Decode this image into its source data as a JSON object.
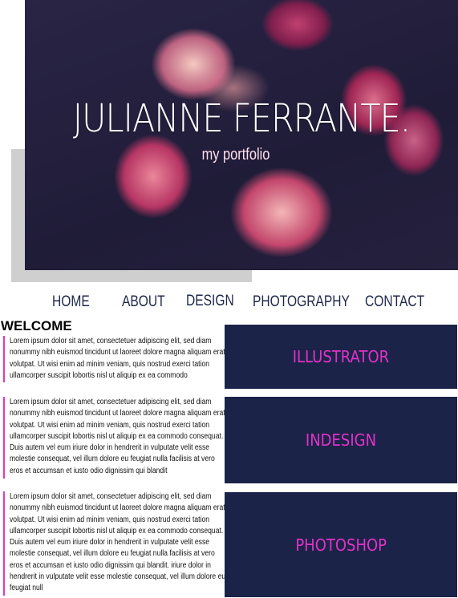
{
  "hero": {
    "title": "JULIANNE FERRANTE.",
    "subtitle": "my portfolio"
  },
  "nav": {
    "items": [
      "HOME",
      "ABOUT",
      "DESIGN",
      "PHOTOGRAPHY",
      "CONTACT"
    ]
  },
  "welcome": {
    "heading": "WELCOME"
  },
  "paragraphs": [
    "Lorem ipsum dolor sit amet, consectetuer adipiscing elit, sed diam nonummy nibh euismod tincidunt ut laoreet dolore magna aliquam erat volutpat. Ut wisi enim ad minim veniam, quis nostrud exerci tation ullamcorper suscipit lobortis nisl ut aliquip ex ea commodo",
    "Lorem ipsum dolor sit amet, consectetuer adipiscing elit, sed diam nonummy nibh euismod tincidunt ut laoreet dolore magna aliquam erat volutpat. Ut wisi enim ad minim veniam, quis nostrud exerci tation ullamcorper suscipit lobortis nisl ut aliquip ex ea commodo consequat. Duis autem vel eum iriure dolor in hendrerit in vulputate velit esse molestie consequat, vel illum dolore eu feugiat nulla facilisis at vero eros et accumsan et iusto odio dignissim qui blandit",
    "Lorem ipsum dolor sit amet, consectetuer adipiscing elit, sed diam nonummy nibh euismod tincidunt ut laoreet dolore magna aliquam erat volutpat. Ut wisi enim ad minim veniam, quis nostrud exerci tation ullamcorper suscipit lobortis nisl ut aliquip ex ea commodo consequat. Duis autem vel eum iriure dolor in hendrerit in vulputate velit esse molestie consequat, vel illum dolore eu feugiat nulla facilisis at vero eros et accumsan et iusto odio dignissim qui blandit. iriure dolor in hendrerit in vulputate velit esse molestie consequat, vel illum dolore eu feugiat null"
  ],
  "tiles": [
    {
      "label": "ILLUSTRATOR"
    },
    {
      "label": "INDESIGN"
    },
    {
      "label": "PHOTOSHOP"
    }
  ],
  "colors": {
    "navy": "#1c2348",
    "magenta": "#e033c8",
    "nav_text": "#1f2749",
    "shadow": "#cfcfcf"
  }
}
